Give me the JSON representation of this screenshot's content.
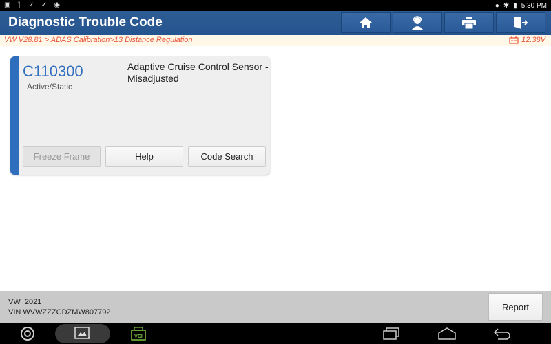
{
  "statusbar": {
    "left_icons": [
      "gallery-icon",
      "usb-debug-icon",
      "check-icon",
      "check-icon",
      "app-icon"
    ],
    "time": "5:30 PM"
  },
  "header": {
    "title": "Diagnostic Trouble Code",
    "buttons": [
      "home-icon",
      "support-icon",
      "print-icon",
      "exit-icon"
    ]
  },
  "breadcrumb": {
    "path": "VW V28.81 > ADAS Calibration>13 Distance Regulation",
    "voltage": "12.38V"
  },
  "dtc": {
    "code": "C110300",
    "status": "Active/Static",
    "description": "Adaptive Cruise Control Sensor - Misadjusted",
    "buttons": {
      "freeze_frame": "Freeze Frame",
      "help": "Help",
      "code_search": "Code Search"
    },
    "accent": "#2f6dbd"
  },
  "footer": {
    "vehicle": "VW  2021",
    "vin": "VIN WVWZZZCDZMW807792",
    "report": "Report"
  },
  "navbar": {
    "vci_label": "VCI"
  }
}
